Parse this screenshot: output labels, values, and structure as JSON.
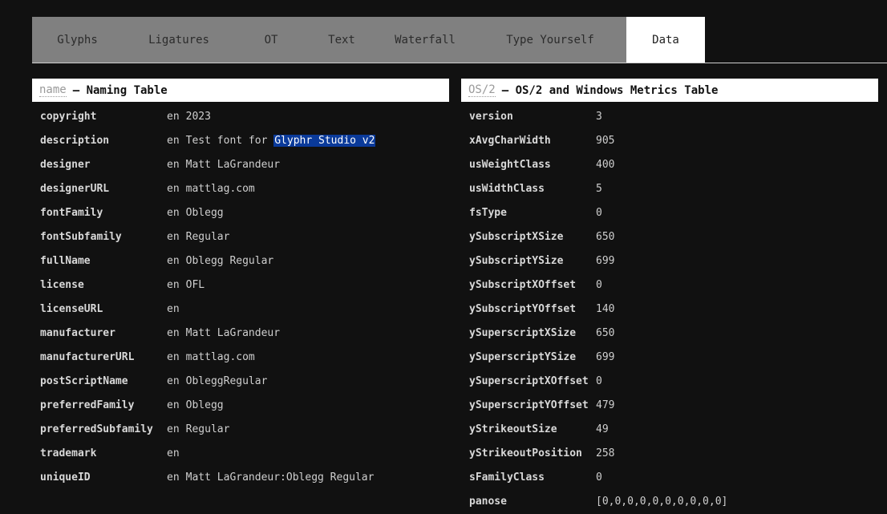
{
  "tabs": [
    {
      "label": "Glyphs",
      "width": 113
    },
    {
      "label": "Ligatures",
      "width": 140
    },
    {
      "label": "OT",
      "width": 90
    },
    {
      "label": "Text",
      "width": 86
    },
    {
      "label": "Waterfall",
      "width": 122
    },
    {
      "label": "Type Yourself",
      "width": 190
    },
    {
      "label": "Data",
      "width": 98,
      "active": true
    }
  ],
  "name_table": {
    "tag": "name",
    "title": "– Naming Table",
    "rows": [
      {
        "key": "copyright",
        "lang": "en",
        "value": "2023"
      },
      {
        "key": "description",
        "lang": "en",
        "value": "Test font for ",
        "highlight": "Glyphr Studio v2"
      },
      {
        "key": "designer",
        "lang": "en",
        "value": "Matt LaGrandeur"
      },
      {
        "key": "designerURL",
        "lang": "en",
        "value": "mattlag.com"
      },
      {
        "key": "fontFamily",
        "lang": "en",
        "value": "Oblegg"
      },
      {
        "key": "fontSubfamily",
        "lang": "en",
        "value": "Regular"
      },
      {
        "key": "fullName",
        "lang": "en",
        "value": "Oblegg Regular"
      },
      {
        "key": "license",
        "lang": "en",
        "value": "OFL"
      },
      {
        "key": "licenseURL",
        "lang": "en",
        "value": ""
      },
      {
        "key": "manufacturer",
        "lang": "en",
        "value": "Matt LaGrandeur"
      },
      {
        "key": "manufacturerURL",
        "lang": "en",
        "value": "mattlag.com"
      },
      {
        "key": "postScriptName",
        "lang": "en",
        "value": "ObleggRegular"
      },
      {
        "key": "preferredFamily",
        "lang": "en",
        "value": "Oblegg"
      },
      {
        "key": "preferredSubfamily",
        "lang": "en",
        "value": "Regular"
      },
      {
        "key": "trademark",
        "lang": "en",
        "value": ""
      },
      {
        "key": "uniqueID",
        "lang": "en",
        "value": "Matt LaGrandeur:Oblegg Regular"
      }
    ]
  },
  "os2_table": {
    "tag": "OS/2",
    "title": "– OS/2 and Windows Metrics Table",
    "rows": [
      {
        "key": "version",
        "value": "3"
      },
      {
        "key": "xAvgCharWidth",
        "value": "905"
      },
      {
        "key": "usWeightClass",
        "value": "400"
      },
      {
        "key": "usWidthClass",
        "value": "5"
      },
      {
        "key": "fsType",
        "value": "0"
      },
      {
        "key": "ySubscriptXSize",
        "value": "650"
      },
      {
        "key": "ySubscriptYSize",
        "value": "699"
      },
      {
        "key": "ySubscriptXOffset",
        "value": "0"
      },
      {
        "key": "ySubscriptYOffset",
        "value": "140"
      },
      {
        "key": "ySuperscriptXSize",
        "value": "650"
      },
      {
        "key": "ySuperscriptYSize",
        "value": "699"
      },
      {
        "key": "ySuperscriptXOffset",
        "value": "0"
      },
      {
        "key": "ySuperscriptYOffset",
        "value": "479"
      },
      {
        "key": "yStrikeoutSize",
        "value": "49"
      },
      {
        "key": "yStrikeoutPosition",
        "value": "258"
      },
      {
        "key": "sFamilyClass",
        "value": "0"
      },
      {
        "key": "panose",
        "value": "[0,0,0,0,0,0,0,0,0,0]"
      }
    ]
  }
}
